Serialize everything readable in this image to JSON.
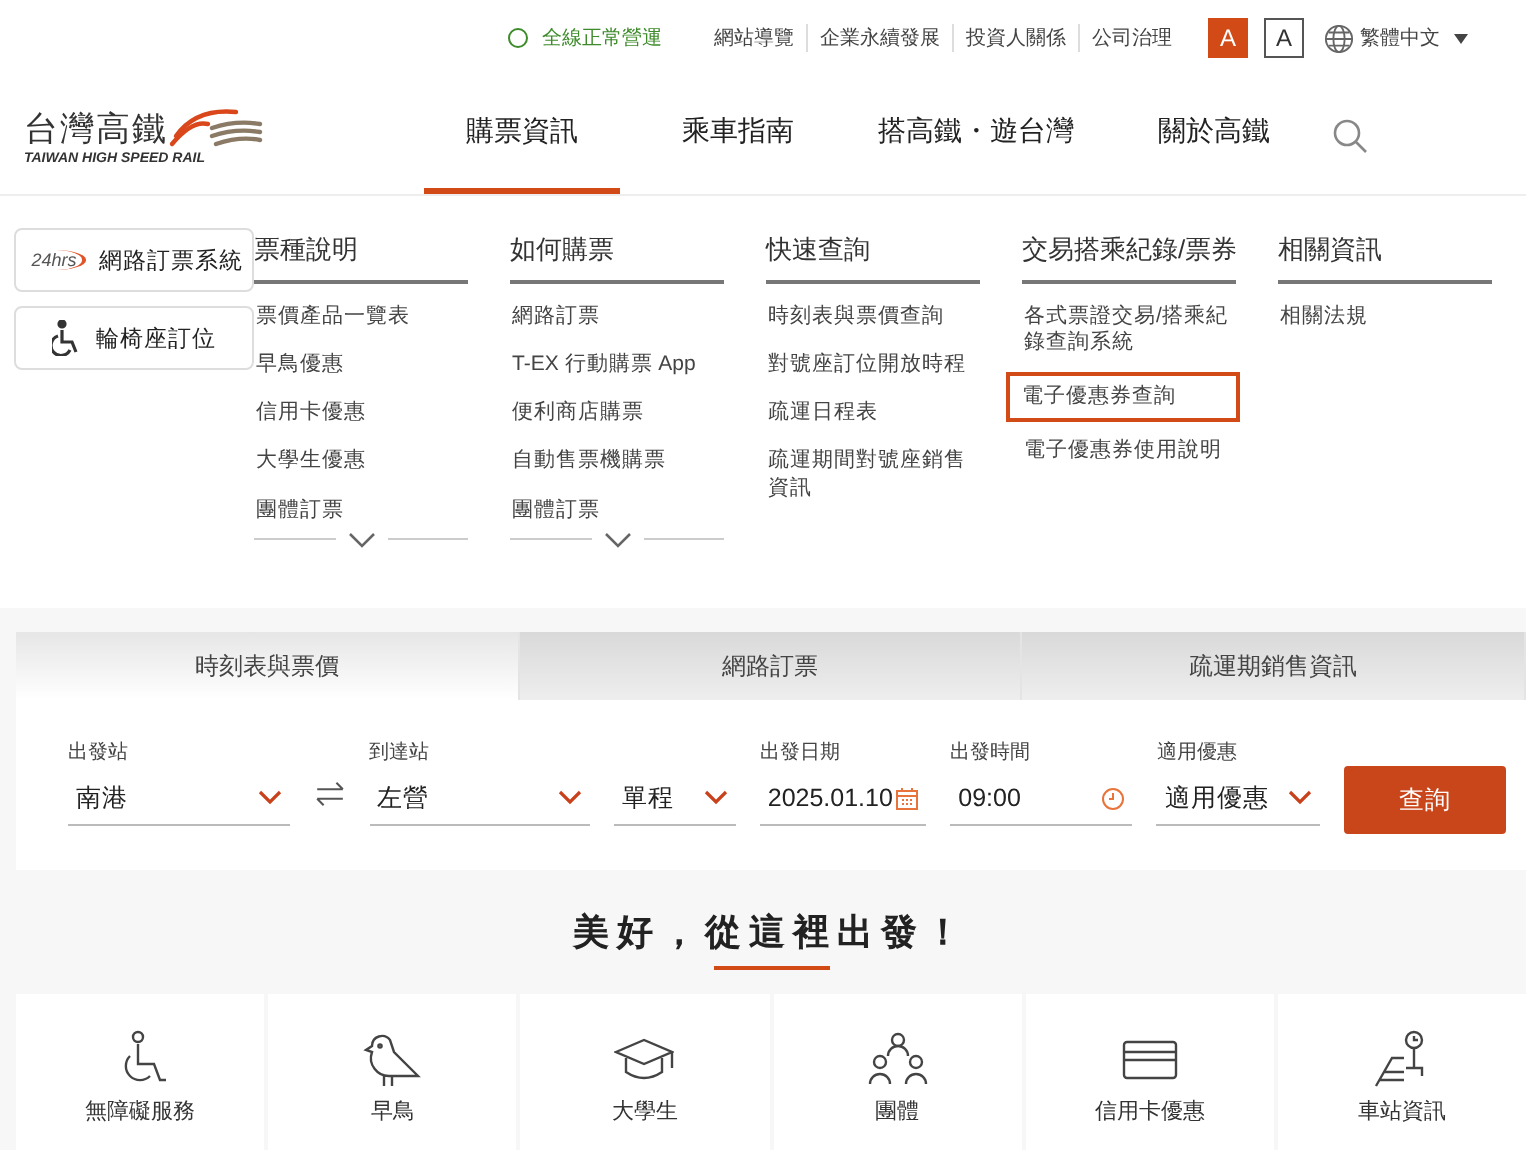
{
  "top_bar": {
    "status": "全線正常營運",
    "links": [
      "網站導覽",
      "企業永續發展",
      "投資人關係",
      "公司治理"
    ],
    "font_sizes": [
      {
        "label": "A",
        "selected": true
      },
      {
        "label": "A",
        "selected": false
      }
    ],
    "language": "繁體中文"
  },
  "logo": {
    "name": "台灣高鐵",
    "subtitle": "TAIWAN HIGH SPEED RAIL"
  },
  "nav": [
    {
      "label": "購票資訊",
      "selected": true
    },
    {
      "label": "乘車指南",
      "selected": false
    },
    {
      "label": "搭高鐵・遊台灣",
      "selected": false
    },
    {
      "label": "關於高鐵",
      "selected": false
    }
  ],
  "quick_buttons": [
    {
      "kind": "online",
      "badge": "24hrs",
      "label": "網路訂票系統"
    },
    {
      "kind": "wheelchair",
      "label": "輪椅座訂位"
    }
  ],
  "menu_columns": [
    {
      "heading": "票種說明",
      "more": true,
      "items": [
        {
          "label": "票價產品一覽表",
          "focused": false
        },
        {
          "label": "早鳥優惠",
          "focused": false
        },
        {
          "label": "信用卡優惠",
          "focused": false
        },
        {
          "label": "大學生優惠",
          "focused": false
        },
        {
          "label": "團體訂票",
          "focused": false
        }
      ]
    },
    {
      "heading": "如何購票",
      "more": true,
      "items": [
        {
          "label": "網路訂票",
          "focused": false
        },
        {
          "label": "T-EX 行動購票 App",
          "focused": false
        },
        {
          "label": "便利商店購票",
          "focused": false
        },
        {
          "label": "自動售票機購票",
          "focused": false
        },
        {
          "label": "團體訂票",
          "focused": false
        }
      ]
    },
    {
      "heading": "快速查詢",
      "more": false,
      "items": [
        {
          "label": "時刻表與票價查詢",
          "focused": false
        },
        {
          "label": "對號座訂位開放時程",
          "focused": false
        },
        {
          "label": "疏運日程表",
          "focused": false
        },
        {
          "label": "疏運期間對號座銷售資訊",
          "focused": false
        }
      ]
    },
    {
      "heading": "交易搭乘紀錄/票券",
      "more": false,
      "items": [
        {
          "label": "各式票證交易/搭乘紀錄查詢系統",
          "focused": false
        },
        {
          "label": "電子優惠券查詢",
          "focused": true
        },
        {
          "label": "電子優惠券使用說明",
          "focused": false
        }
      ]
    },
    {
      "heading": "相關資訊",
      "more": false,
      "items": [
        {
          "label": "相關法規",
          "focused": false
        }
      ]
    }
  ],
  "booking_tabs": [
    {
      "label": "時刻表與票價",
      "selected": true
    },
    {
      "label": "網路訂票",
      "selected": false
    },
    {
      "label": "疏運期銷售資訊",
      "selected": false
    }
  ],
  "booking_form": {
    "fields": [
      {
        "kind": "select",
        "label": "出發站",
        "value": "南港"
      },
      {
        "kind": "swap"
      },
      {
        "kind": "select",
        "label": "到達站",
        "value": "左營"
      },
      {
        "kind": "select",
        "value": "單程"
      },
      {
        "kind": "date",
        "label": "出發日期",
        "value": "2025.01.10"
      },
      {
        "kind": "time",
        "label": "出發時間",
        "value": "09:00"
      },
      {
        "kind": "select",
        "label": "適用優惠",
        "value": "適用優惠"
      }
    ],
    "submit": "查詢"
  },
  "section_title": "美好，從這裡出發！",
  "features": [
    {
      "kind": "wheelchair",
      "label": "無障礙服務"
    },
    {
      "kind": "bird",
      "label": "早鳥"
    },
    {
      "kind": "cap",
      "label": "大學生"
    },
    {
      "kind": "group",
      "label": "團體"
    },
    {
      "kind": "card",
      "label": "信用卡優惠"
    },
    {
      "kind": "station",
      "label": "車站資訊"
    }
  ]
}
